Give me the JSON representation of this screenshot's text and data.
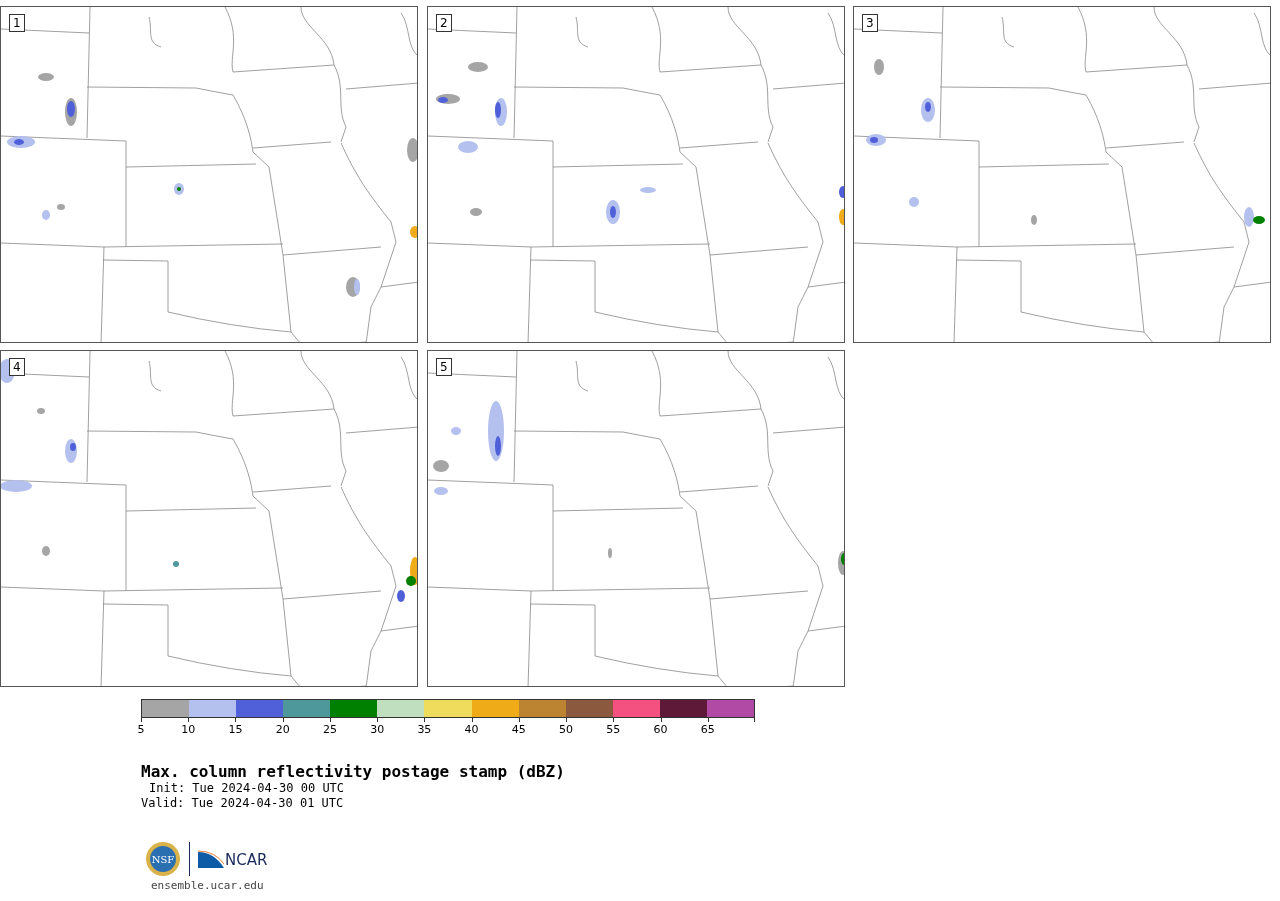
{
  "panels": [
    {
      "label": "1"
    },
    {
      "label": "2"
    },
    {
      "label": "3"
    },
    {
      "label": "4"
    },
    {
      "label": "5"
    }
  ],
  "colorbar": {
    "bins": [
      {
        "color": "#a5a5a5"
      },
      {
        "color": "#b4c0ee"
      },
      {
        "color": "#5060d8"
      },
      {
        "color": "#4e979b"
      },
      {
        "color": "#008000"
      },
      {
        "color": "#bfdfbf"
      },
      {
        "color": "#f0dc5c"
      },
      {
        "color": "#f0ac18"
      },
      {
        "color": "#bc8430"
      },
      {
        "color": "#8b5a3e"
      },
      {
        "color": "#f45080"
      },
      {
        "color": "#5e1838"
      },
      {
        "color": "#b04aa4"
      }
    ],
    "ticks": [
      "5",
      "10",
      "15",
      "20",
      "25",
      "30",
      "35",
      "40",
      "45",
      "50",
      "55",
      "60",
      "65"
    ]
  },
  "title": "Max. column reflectivity postage stamp (dBZ)",
  "init": "Init: Tue 2024-04-30 00 UTC",
  "valid": "Valid: Tue 2024-04-30 01 UTC",
  "logo": {
    "nsf": "NSF",
    "ncar": "NCAR"
  },
  "url": "ensemble.ucar.edu"
}
